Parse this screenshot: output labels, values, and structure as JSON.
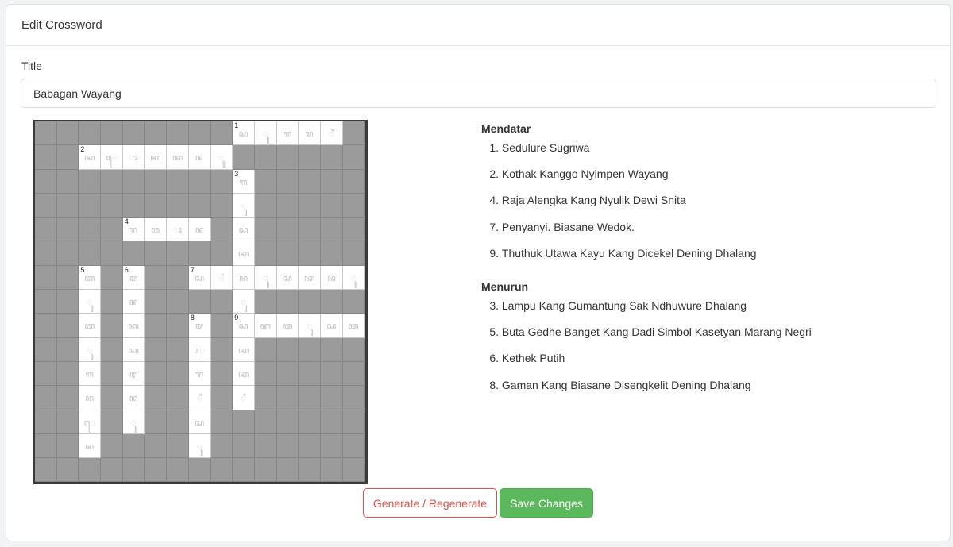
{
  "header": {
    "title": "Edit Crossword"
  },
  "form": {
    "title_label": "Title",
    "title_value": "Babagan Wayang"
  },
  "crossword": {
    "rows": 15,
    "cols": 15,
    "cells": [
      {
        "r": 0,
        "c": 9,
        "num": "1",
        "ch": "ꦱ"
      },
      {
        "r": 0,
        "c": 10,
        "ch": "ꦸ"
      },
      {
        "r": 0,
        "c": 11,
        "ch": "ꦒ"
      },
      {
        "r": 0,
        "c": 12,
        "ch": "ꦫ"
      },
      {
        "r": 0,
        "c": 13,
        "ch": "ꦶ"
      },
      {
        "r": 1,
        "c": 2,
        "num": "2",
        "ch": "ꦏ"
      },
      {
        "r": 1,
        "c": 3,
        "ch": "ꦺ"
      },
      {
        "r": 1,
        "c": 4,
        "ch": "ꦴ"
      },
      {
        "r": 1,
        "c": 5,
        "ch": "ꦏ"
      },
      {
        "r": 1,
        "c": 6,
        "ch": "ꦏ"
      },
      {
        "r": 1,
        "c": 7,
        "ch": "ꦤ"
      },
      {
        "r": 1,
        "c": 8,
        "ch": "ꦸ"
      },
      {
        "r": 2,
        "c": 9,
        "num": "3",
        "ch": "ꦒ"
      },
      {
        "r": 3,
        "c": 9,
        "ch": "ꦸ"
      },
      {
        "r": 4,
        "c": 4,
        "num": "4",
        "ch": "ꦫ"
      },
      {
        "r": 4,
        "c": 5,
        "ch": "ꦮ"
      },
      {
        "r": 4,
        "c": 6,
        "ch": "ꦴ"
      },
      {
        "r": 4,
        "c": 7,
        "ch": "ꦤ"
      },
      {
        "r": 4,
        "c": 9,
        "ch": "ꦱ"
      },
      {
        "r": 5,
        "c": 9,
        "ch": "ꦏ"
      },
      {
        "r": 6,
        "c": 2,
        "num": "5",
        "ch": "ꦧ"
      },
      {
        "r": 6,
        "c": 4,
        "num": "6",
        "ch": "ꦩ"
      },
      {
        "r": 6,
        "c": 7,
        "num": "7",
        "ch": "ꦱ"
      },
      {
        "r": 6,
        "c": 8,
        "ch": "ꦶ"
      },
      {
        "r": 6,
        "c": 9,
        "ch": "ꦤ"
      },
      {
        "r": 6,
        "c": 10,
        "ch": "ꦸ"
      },
      {
        "r": 6,
        "c": 11,
        "ch": "ꦱ"
      },
      {
        "r": 6,
        "c": 12,
        "ch": "ꦏ"
      },
      {
        "r": 6,
        "c": 13,
        "ch": "ꦤ"
      },
      {
        "r": 6,
        "c": 14,
        "ch": "ꦸ"
      },
      {
        "r": 7,
        "c": 2,
        "ch": "ꦸ"
      },
      {
        "r": 7,
        "c": 4,
        "ch": "ꦤ"
      },
      {
        "r": 7,
        "c": 9,
        "ch": "ꦸ"
      },
      {
        "r": 8,
        "c": 2,
        "ch": "ꦠ"
      },
      {
        "r": 8,
        "c": 4,
        "ch": "ꦏ"
      },
      {
        "r": 8,
        "c": 7,
        "num": "8",
        "ch": "ꦩ"
      },
      {
        "r": 8,
        "c": 9,
        "num": "9",
        "ch": "ꦱ"
      },
      {
        "r": 8,
        "c": 10,
        "ch": "ꦏ"
      },
      {
        "r": 8,
        "c": 11,
        "ch": "ꦠ"
      },
      {
        "r": 8,
        "c": 12,
        "ch": "ꦸ"
      },
      {
        "r": 8,
        "c": 13,
        "ch": "ꦱ"
      },
      {
        "r": 8,
        "c": 14,
        "ch": "ꦠ"
      },
      {
        "r": 9,
        "c": 2,
        "ch": "ꦸ"
      },
      {
        "r": 9,
        "c": 4,
        "ch": "ꦏ"
      },
      {
        "r": 9,
        "c": 7,
        "ch": "ꦺ"
      },
      {
        "r": 9,
        "c": 9,
        "ch": "ꦏ"
      },
      {
        "r": 10,
        "c": 2,
        "ch": "ꦒ"
      },
      {
        "r": 10,
        "c": 4,
        "ch": "ꦛ"
      },
      {
        "r": 10,
        "c": 7,
        "ch": "ꦫ"
      },
      {
        "r": 10,
        "c": 9,
        "ch": "ꦏ"
      },
      {
        "r": 11,
        "c": 2,
        "ch": "ꦤ"
      },
      {
        "r": 11,
        "c": 4,
        "ch": "ꦤ"
      },
      {
        "r": 11,
        "c": 7,
        "ch": "ꦶ"
      },
      {
        "r": 11,
        "c": 9,
        "ch": "ꦶ"
      },
      {
        "r": 12,
        "c": 2,
        "ch": "ꦺ"
      },
      {
        "r": 12,
        "c": 4,
        "ch": "ꦸ"
      },
      {
        "r": 12,
        "c": 7,
        "ch": "ꦱ"
      },
      {
        "r": 13,
        "c": 2,
        "ch": "ꦤ"
      },
      {
        "r": 13,
        "c": 7,
        "ch": "ꦸ"
      }
    ]
  },
  "clues": {
    "across_heading": "Mendatar",
    "across": [
      {
        "n": "1.",
        "text": "Sedulure Sugriwa"
      },
      {
        "n": "2.",
        "text": "Kothak Kanggo Nyimpen Wayang"
      },
      {
        "n": "4.",
        "text": "Raja Alengka Kang Nyulik Dewi Snita"
      },
      {
        "n": "7.",
        "text": "Penyanyi. Biasane Wedok."
      },
      {
        "n": "9.",
        "text": "Thuthuk Utawa Kayu Kang Dicekel Dening Dhalang"
      }
    ],
    "down_heading": "Menurun",
    "down": [
      {
        "n": "3.",
        "text": "Lampu Kang Gumantung Sak Ndhuwure Dhalang"
      },
      {
        "n": "5.",
        "text": "Buta Gedhe Banget Kang Dadi Simbol Kasetyan Marang Negri"
      },
      {
        "n": "6.",
        "text": "Kethek Putih"
      },
      {
        "n": "8.",
        "text": "Gaman Kang Biasane Disengkelit Dening Dhalang"
      }
    ]
  },
  "actions": {
    "regenerate_label": "Generate / Regenerate",
    "save_label": "Save Changes"
  },
  "colors": {
    "save": "#5cb85c",
    "regenerate": "#d9534f",
    "block": "#9b9b9b"
  }
}
